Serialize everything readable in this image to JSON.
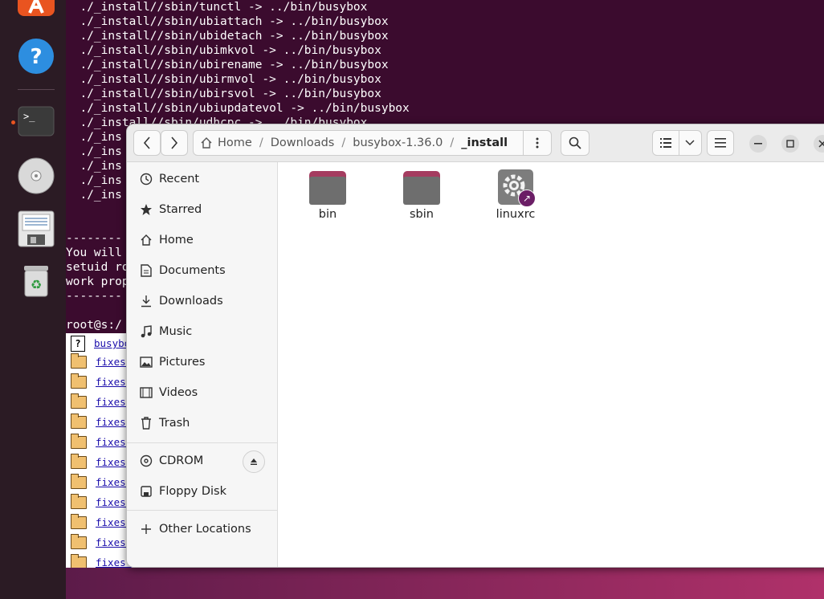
{
  "terminal": {
    "lines": [
      "  ./_install//sbin/tunctl -> ../bin/busybox",
      "  ./_install//sbin/ubiattach -> ../bin/busybox",
      "  ./_install//sbin/ubidetach -> ../bin/busybox",
      "  ./_install//sbin/ubimkvol -> ../bin/busybox",
      "  ./_install//sbin/ubirename -> ../bin/busybox",
      "  ./_install//sbin/ubirmvol -> ../bin/busybox",
      "  ./_install//sbin/ubirsvol -> ../bin/busybox",
      "  ./_install//sbin/ubiupdatevol -> ../bin/busybox",
      "  ./_install//sbin/udhcpc -> ../bin/busybox",
      "  ./_ins",
      "  ./_ins",
      "  ./_ins",
      "  ./_ins",
      "  ./_ins",
      "",
      "",
      "--------",
      "You will",
      "setuid ro",
      "work prop",
      "--------",
      "",
      "root@s:/"
    ]
  },
  "listing": {
    "items": [
      "busybo",
      "fixes-",
      "fixes-",
      "fixes-",
      "fixes-",
      "fixes-",
      "fixes-",
      "fixes-",
      "fixes-",
      "fixes-",
      "fixes-",
      "fixes-"
    ]
  },
  "file_manager": {
    "path": {
      "home": "Home",
      "segments": [
        "Downloads",
        "busybox-1.36.0"
      ],
      "current": "_install"
    },
    "sidebar": {
      "places": [
        "Recent",
        "Starred",
        "Home",
        "Documents",
        "Downloads",
        "Music",
        "Pictures",
        "Videos",
        "Trash"
      ],
      "devices": [
        "CDROM",
        "Floppy Disk"
      ],
      "other": "Other Locations"
    },
    "files": [
      {
        "name": "bin",
        "type": "folder"
      },
      {
        "name": "sbin",
        "type": "folder"
      },
      {
        "name": "linuxrc",
        "type": "executable-link"
      }
    ]
  },
  "colors": {
    "terminal_bg": "#3b0b2e",
    "ubuntu_orange": "#e95420",
    "folder_tab": "#a53c60",
    "folder_body": "#6e6e6e"
  }
}
